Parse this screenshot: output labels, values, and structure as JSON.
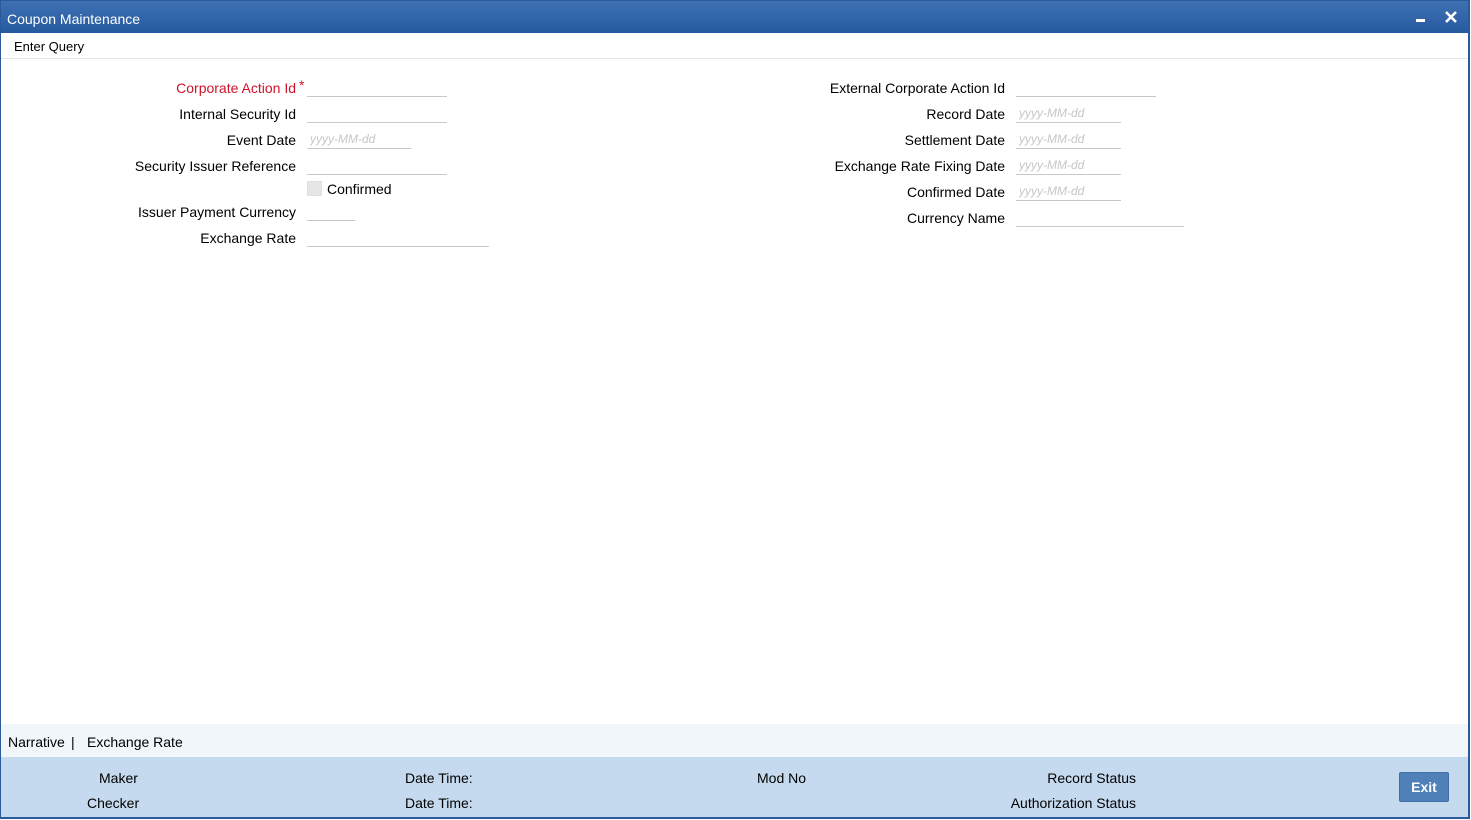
{
  "window": {
    "title": "Coupon Maintenance",
    "minimize_icon": "minimize-icon",
    "close_icon": "close-icon"
  },
  "toolbar": {
    "enter_query": "Enter Query"
  },
  "form_left": {
    "corporate_action_id": {
      "label": "Corporate Action Id",
      "required_mark": "*",
      "value": ""
    },
    "internal_security_id": {
      "label": "Internal Security Id",
      "value": ""
    },
    "event_date": {
      "label": "Event Date",
      "placeholder": "yyyy-MM-dd",
      "value": ""
    },
    "security_issuer_reference": {
      "label": "Security Issuer Reference",
      "value": ""
    },
    "confirmed": {
      "label": "Confirmed",
      "checked": false
    },
    "issuer_payment_currency": {
      "label": "Issuer Payment Currency",
      "value": ""
    },
    "exchange_rate": {
      "label": "Exchange Rate",
      "value": ""
    }
  },
  "form_right": {
    "external_corporate_action_id": {
      "label": "External Corporate Action Id",
      "value": ""
    },
    "record_date": {
      "label": "Record Date",
      "placeholder": "yyyy-MM-dd",
      "value": ""
    },
    "settlement_date": {
      "label": "Settlement Date",
      "placeholder": "yyyy-MM-dd",
      "value": ""
    },
    "exchange_rate_fixing_date": {
      "label": "Exchange Rate Fixing Date",
      "placeholder": "yyyy-MM-dd",
      "value": ""
    },
    "confirmed_date": {
      "label": "Confirmed Date",
      "placeholder": "yyyy-MM-dd",
      "value": ""
    },
    "currency_name": {
      "label": "Currency Name",
      "value": ""
    }
  },
  "subtabs": {
    "narrative": "Narrative",
    "separator": "|",
    "exchange_rate": "Exchange Rate"
  },
  "audit": {
    "maker": "Maker",
    "checker": "Checker",
    "date_time_1": "Date Time:",
    "date_time_2": "Date Time:",
    "mod_no": "Mod No",
    "record_status": "Record Status",
    "authorization_status": "Authorization Status",
    "exit": "Exit"
  },
  "colors": {
    "titlebar": "#265a9f",
    "required": "#d0112b",
    "audit_bg": "#c5daee",
    "exit_button": "#4f80b8"
  }
}
